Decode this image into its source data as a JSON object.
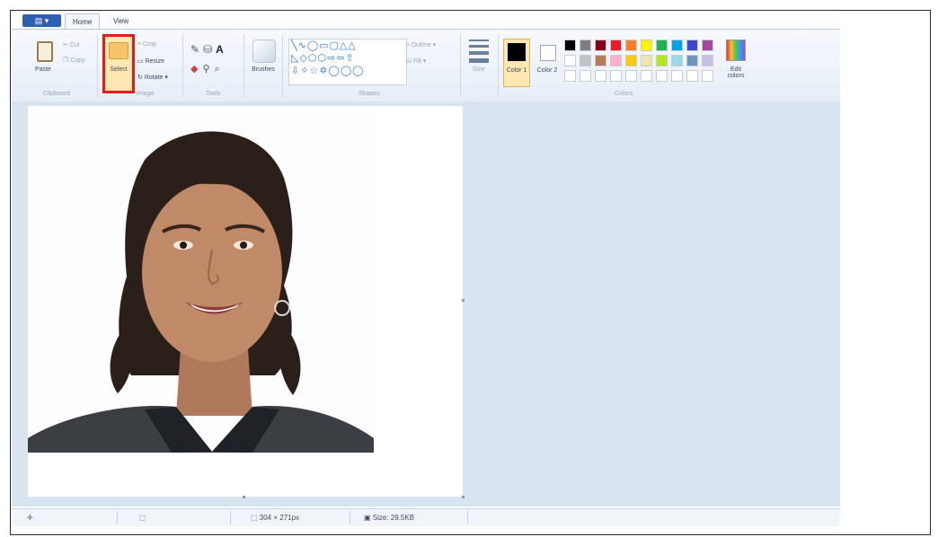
{
  "tabs": [
    {
      "label": "Home",
      "active": true
    },
    {
      "label": "View",
      "active": false
    }
  ],
  "clipboard": {
    "paste": "Paste",
    "cut": "Cut",
    "copy": "Copy",
    "group": "Clipboard"
  },
  "image": {
    "select": "Select",
    "crop": "Crop",
    "resize": "Resize",
    "rotate": "Rotate",
    "group": "Image"
  },
  "tools": {
    "group": "Tools"
  },
  "brushes": {
    "label": "Brushes"
  },
  "shapes": {
    "outline": "Outline",
    "fill": "Fill",
    "group": "Shapes"
  },
  "size": {
    "label": "Size"
  },
  "colors": {
    "color1": "Color 1",
    "color2": "Color 2",
    "edit": "Edit colors",
    "group": "Colors",
    "palette_row1": [
      "#000000",
      "#7f7f7f",
      "#880015",
      "#ed1c24",
      "#ff7f27",
      "#fff200",
      "#22b14c",
      "#00a2e8",
      "#3f48cc",
      "#a349a4"
    ],
    "palette_row2": [
      "#ffffff",
      "#c3c3c3",
      "#b97a57",
      "#ffaec9",
      "#ffc90e",
      "#efe4b0",
      "#b5e61d",
      "#99d9ea",
      "#7092be",
      "#c8bfe7"
    ]
  },
  "status": {
    "dimensions": "304 × 271px",
    "size": "Size: 29.5KB"
  },
  "highlight_color": "#e41b17"
}
